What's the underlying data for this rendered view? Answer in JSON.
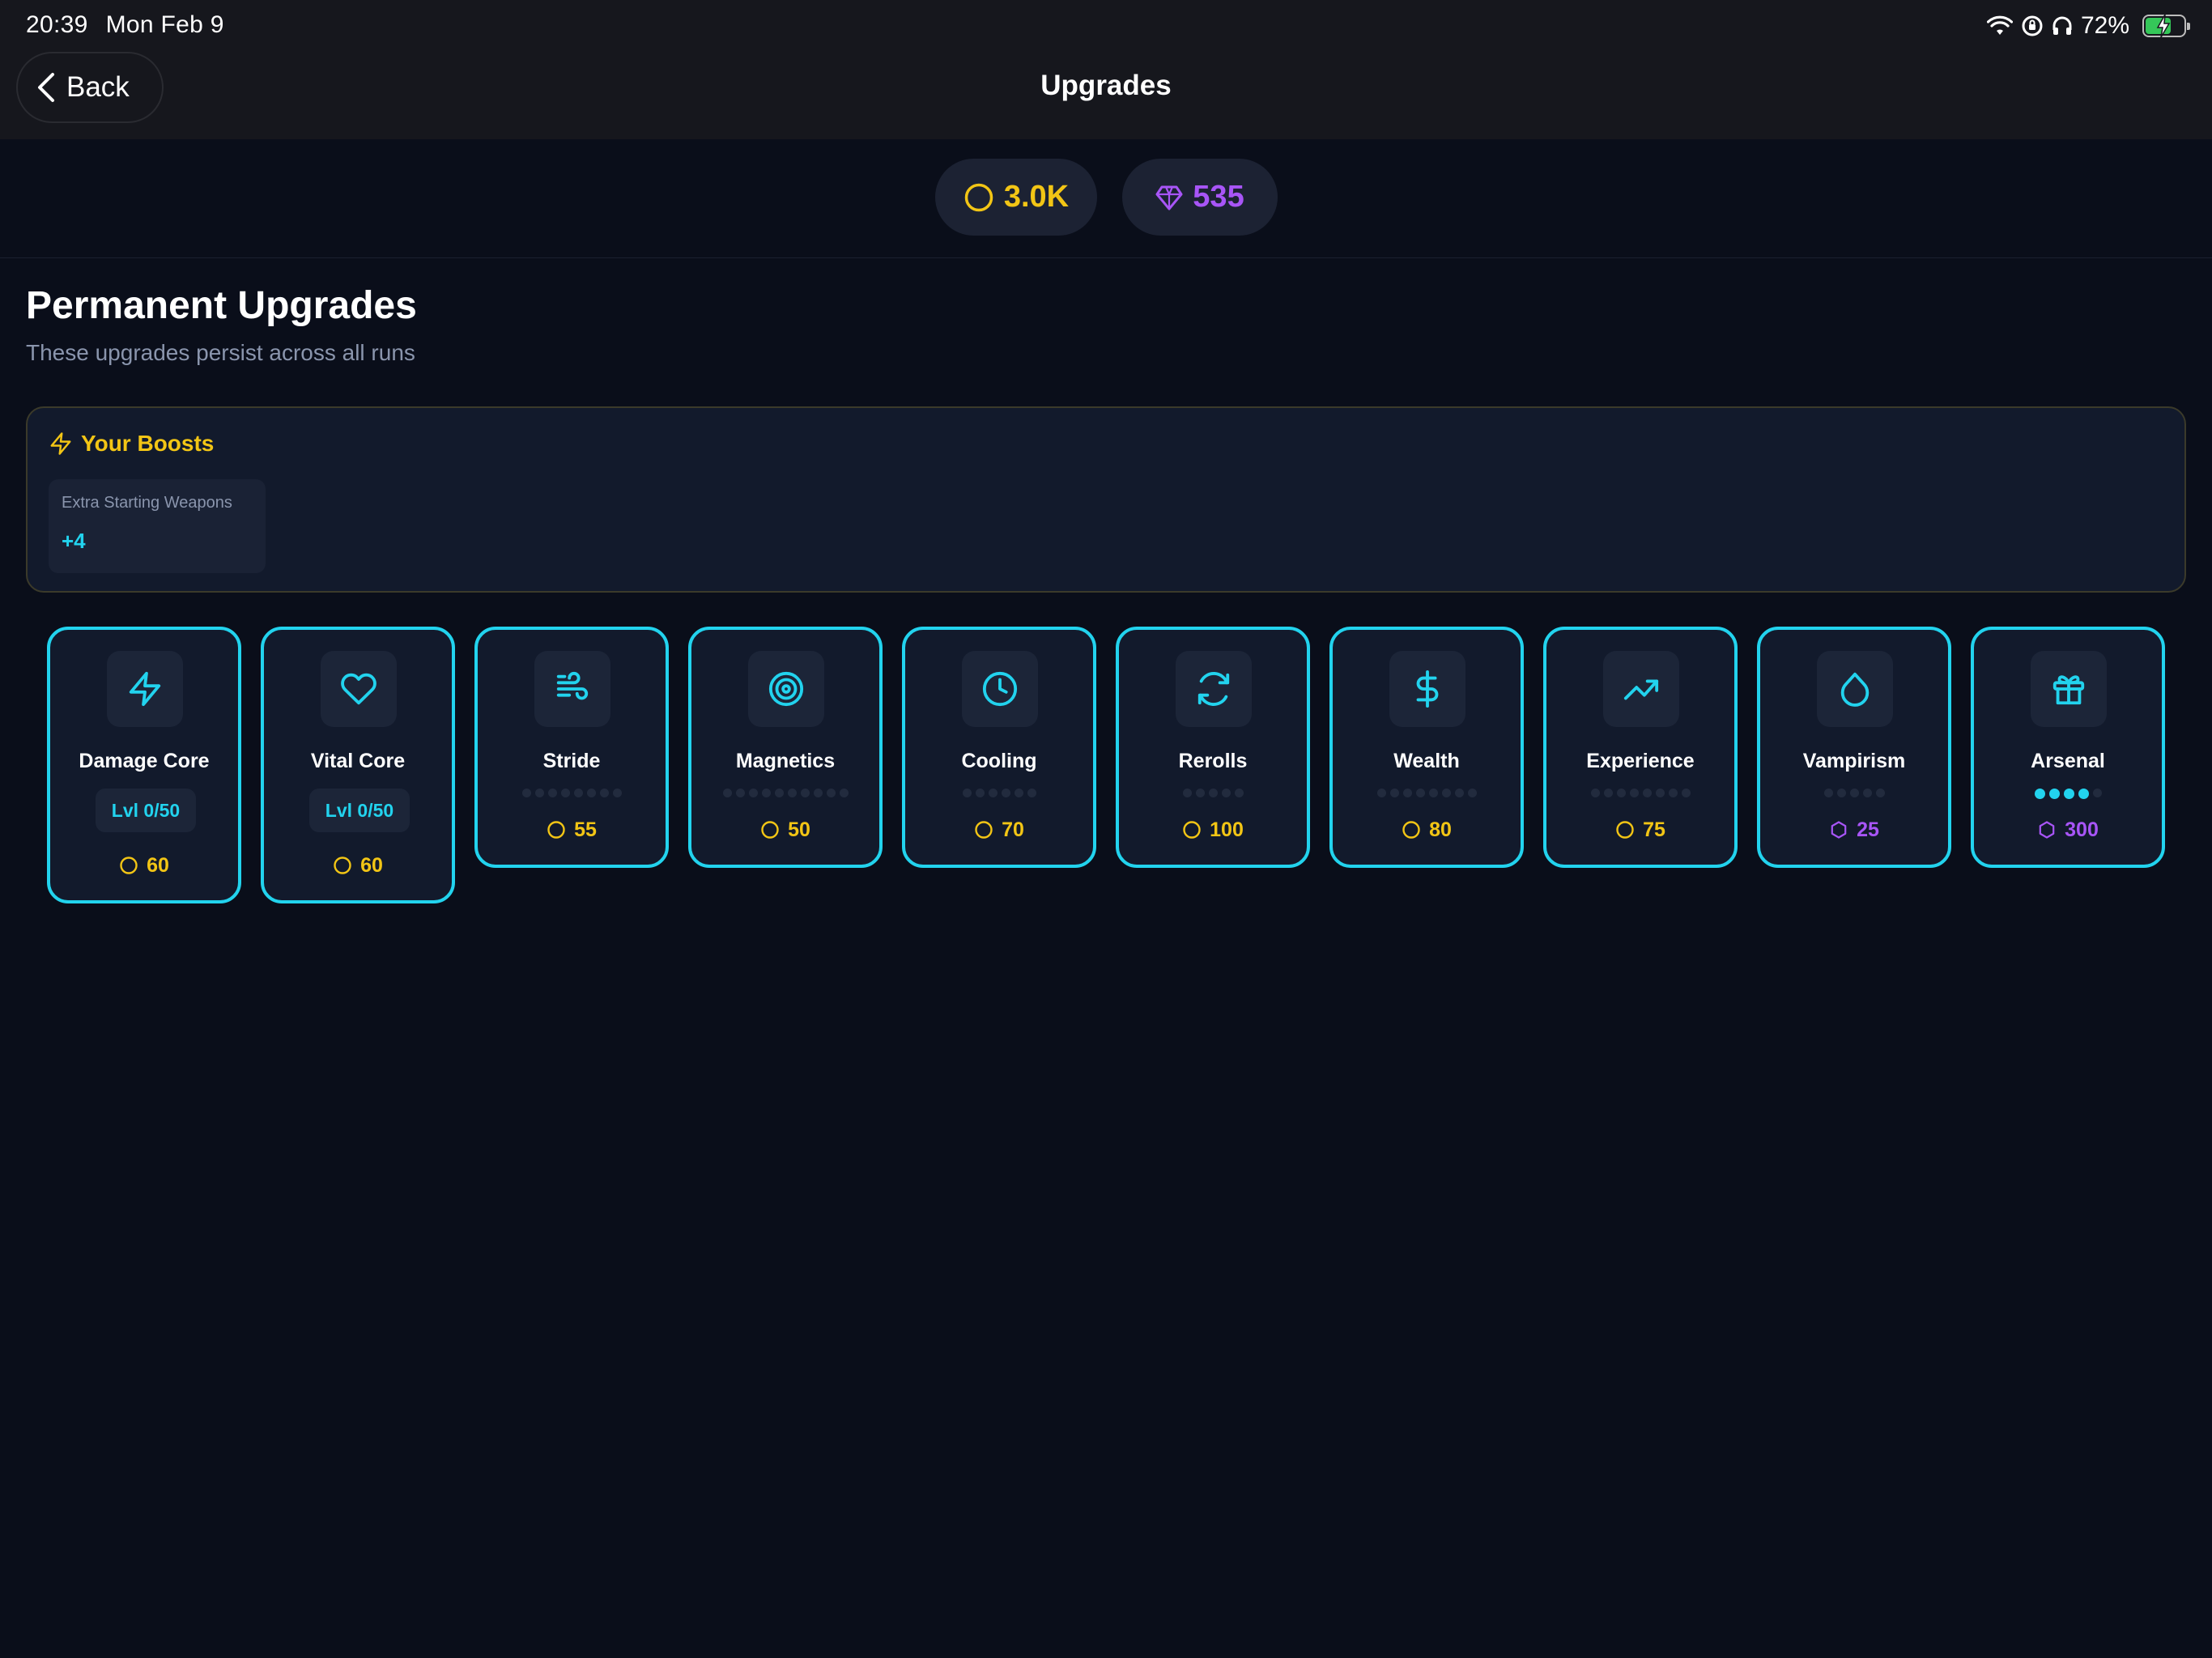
{
  "status_bar": {
    "time": "20:39",
    "date": "Mon Feb 9",
    "battery": "72%",
    "battery_level": 0.72
  },
  "header": {
    "back_label": "Back",
    "title": "Upgrades"
  },
  "currency": {
    "coins": "3.0K",
    "gems": "535"
  },
  "section": {
    "title": "Permanent Upgrades",
    "subtitle": "These upgrades persist across all runs"
  },
  "boosts": {
    "title": "Your Boosts",
    "items": [
      {
        "label": "Extra Starting Weapons",
        "value": "+4"
      }
    ]
  },
  "upgrades": [
    {
      "name": "Damage Core",
      "icon": "bolt-icon",
      "level": "Lvl 0/50",
      "cost": "60",
      "currency": "coin"
    },
    {
      "name": "Vital Core",
      "icon": "heart-icon",
      "level": "Lvl 0/50",
      "cost": "60",
      "currency": "coin"
    },
    {
      "name": "Stride",
      "icon": "wind-icon",
      "dots_total": 8,
      "dots_filled": 0,
      "cost": "55",
      "currency": "coin"
    },
    {
      "name": "Magnetics",
      "icon": "target-icon",
      "dots_total": 10,
      "dots_filled": 0,
      "cost": "50",
      "currency": "coin"
    },
    {
      "name": "Cooling",
      "icon": "clock-icon",
      "dots_total": 6,
      "dots_filled": 0,
      "cost": "70",
      "currency": "coin"
    },
    {
      "name": "Rerolls",
      "icon": "refresh-icon",
      "dots_total": 5,
      "dots_filled": 0,
      "cost": "100",
      "currency": "coin"
    },
    {
      "name": "Wealth",
      "icon": "dollar-icon",
      "dots_total": 8,
      "dots_filled": 0,
      "cost": "80",
      "currency": "coin"
    },
    {
      "name": "Experience",
      "icon": "trending-up-icon",
      "dots_total": 8,
      "dots_filled": 0,
      "cost": "75",
      "currency": "coin"
    },
    {
      "name": "Vampirism",
      "icon": "droplet-icon",
      "dots_total": 5,
      "dots_filled": 0,
      "cost": "25",
      "currency": "gem"
    },
    {
      "name": "Arsenal",
      "icon": "gift-icon",
      "dots_total": 5,
      "dots_filled": 4,
      "cost": "300",
      "currency": "gem"
    }
  ],
  "colors": {
    "background": "#0a0e1a",
    "card": "#121a2c",
    "accent": "#22d3ee",
    "coin": "#f2c515",
    "gem": "#a855f7"
  }
}
